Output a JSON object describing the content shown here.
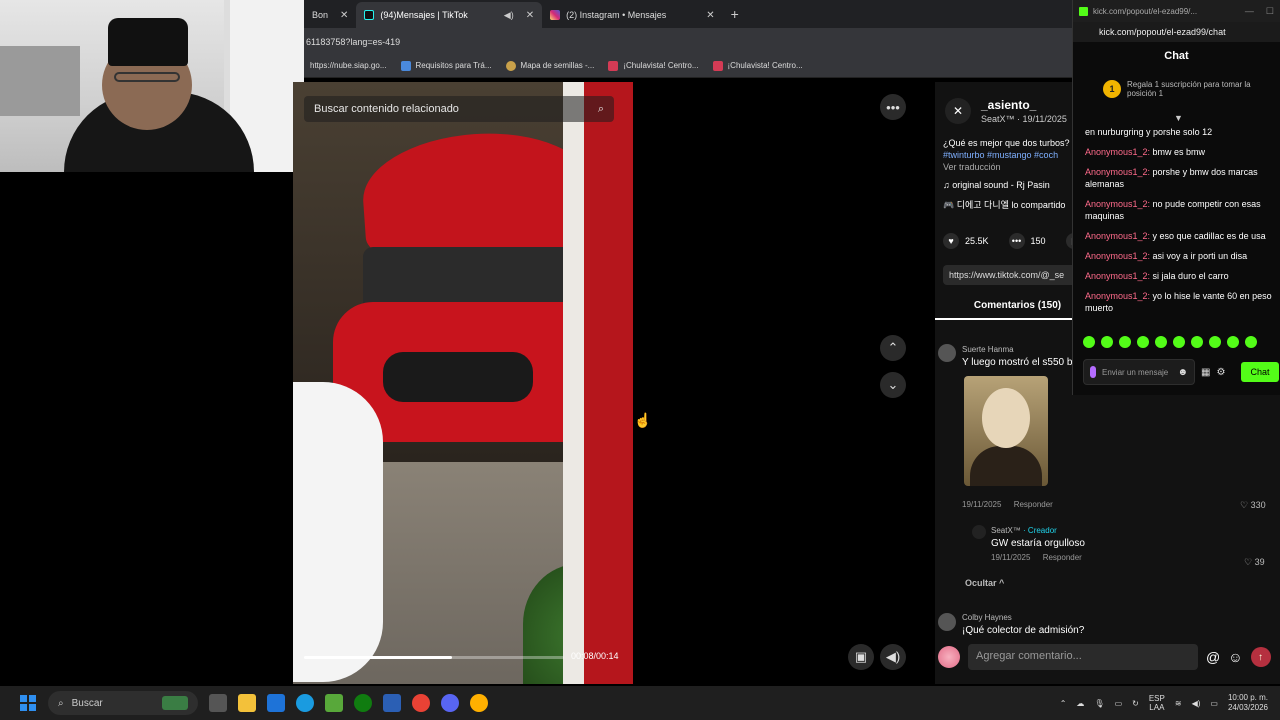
{
  "browser": {
    "tabs": [
      {
        "label": "Bon",
        "active": false
      },
      {
        "label": "(94)Mensajes | TikTok",
        "active": true
      },
      {
        "label": "(2) Instagram • Mensajes",
        "active": false
      }
    ],
    "new_tab": "+",
    "url": "61183758?lang=es-419",
    "bookmarks": [
      "https://nube.siap.go...",
      "Requisitos para Trá...",
      "Mapa de semillas -...",
      "¡Chulavista! Centro...",
      "¡Chulavista! Centro..."
    ]
  },
  "video": {
    "search_placeholder": "Buscar contenido relacionado",
    "time": "00:08/00:14",
    "progress": 0.57
  },
  "post": {
    "author": "_asiento_",
    "author_sub": "SeatX™ · 19/11/2025",
    "caption": "¿Qué es mejor que dos turbos?",
    "tags": "#twinturbo #mustango #coch",
    "translate": "Ver traducción",
    "sound": "original sound - Rj Pasin",
    "shared": "디에고 다니엘 lo compartido",
    "likes": "25.5K",
    "comments_count": "150",
    "link": "https://www.tiktok.com/@_se",
    "comments_tab": "Comentarios (150)"
  },
  "comments": [
    {
      "author": "Suerte Hanma",
      "text": "Y luego mostró el s550 b",
      "date": "19/11/2025",
      "reply": "Responder",
      "likes": "330"
    },
    {
      "author": "SeatX™",
      "badge": "· Creador",
      "text": "GW estaría orgulloso",
      "date": "19/11/2025",
      "reply": "Responder",
      "likes": "39"
    }
  ],
  "hide_label": "Ocultar ^",
  "next_comment": {
    "author": "Colby Haynes",
    "text": "¡Qué colector de admisión?"
  },
  "add_comment_placeholder": "Agregar comentario...",
  "kick": {
    "window_title": "kick.com/popout/el-ezad99/...",
    "url": "kick.com/popout/el-ezad99/chat",
    "chat_title": "Chat",
    "sub_badge": "1",
    "sub_text": "Regala 1 suscripción para tomar la posición 1",
    "messages": [
      {
        "user": "",
        "text": "en nurburgring y porshe solo 12"
      },
      {
        "user": "Anonymous1_2:",
        "text": " bmw es bmw"
      },
      {
        "user": "Anonymous1_2:",
        "text": " porshe y bmw dos marcas alemanas"
      },
      {
        "user": "Anonymous1_2:",
        "text": " no pude competir con esas maquinas"
      },
      {
        "user": "Anonymous1_2:",
        "text": " y eso que cadillac es de usa"
      },
      {
        "user": "Anonymous1_2:",
        "text": " asi voy a ir porti un disa"
      },
      {
        "user": "Anonymous1_2:",
        "text": " si jala duro el carro"
      },
      {
        "user": "Anonymous1_2:",
        "text": " yo lo hise le vante 60 en peso muerto"
      }
    ],
    "input_placeholder": "Enviar un mensaje",
    "chat_button": "Chat"
  },
  "taskbar": {
    "search": "Buscar",
    "lang": "ESP",
    "lang_sub": "LAA",
    "time": "10:00 p. m.",
    "date": "24/03/2026"
  }
}
